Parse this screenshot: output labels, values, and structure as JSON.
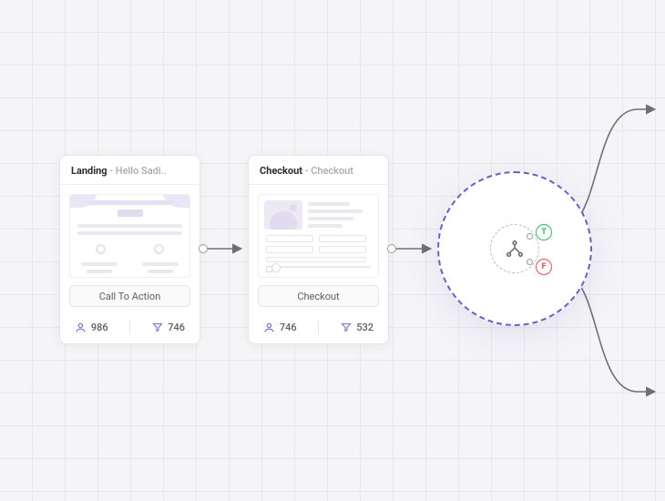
{
  "nodes": {
    "landing": {
      "title_prefix": "Landing",
      "title_suffix": "Hello Sadi..",
      "action_label": "Call To Action",
      "users_count": "986",
      "filter_count": "746"
    },
    "checkout": {
      "title_prefix": "Checkout",
      "title_suffix": "Checkout",
      "action_label": "Checkout",
      "users_count": "746",
      "filter_count": "532"
    }
  },
  "decision": {
    "true_label": "T",
    "false_label": "F"
  },
  "colors": {
    "accent": "#6b5fc7",
    "true": "#2fb66a",
    "false": "#e34d4d",
    "arrow": "#6f6f78"
  }
}
